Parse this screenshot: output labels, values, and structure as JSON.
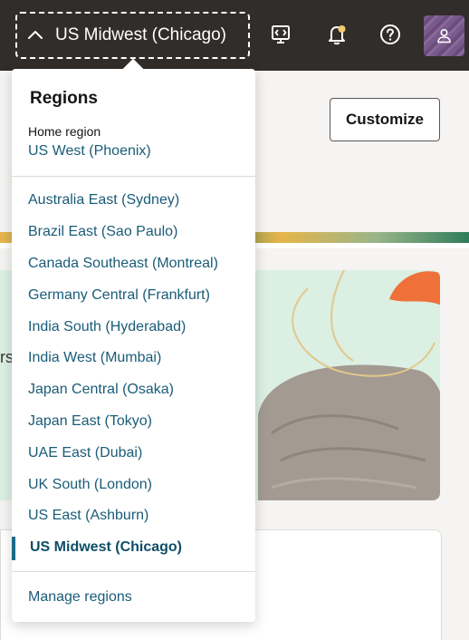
{
  "header": {
    "current_region": "US Midwest (Chicago)"
  },
  "page": {
    "customize_label": "Customize",
    "cutoff_text": "rs"
  },
  "regions_menu": {
    "title": "Regions",
    "home_label": "Home region",
    "home_value": "US West (Phoenix)",
    "items": [
      {
        "label": "Australia East (Sydney)",
        "selected": false
      },
      {
        "label": "Brazil East (Sao Paulo)",
        "selected": false
      },
      {
        "label": "Canada Southeast (Montreal)",
        "selected": false
      },
      {
        "label": "Germany Central (Frankfurt)",
        "selected": false
      },
      {
        "label": "India South (Hyderabad)",
        "selected": false
      },
      {
        "label": "India West (Mumbai)",
        "selected": false
      },
      {
        "label": "Japan Central (Osaka)",
        "selected": false
      },
      {
        "label": "Japan East (Tokyo)",
        "selected": false
      },
      {
        "label": "UAE East (Dubai)",
        "selected": false
      },
      {
        "label": "UK South (London)",
        "selected": false
      },
      {
        "label": "US East (Ashburn)",
        "selected": false
      },
      {
        "label": "US Midwest (Chicago)",
        "selected": true
      }
    ],
    "manage_label": "Manage regions"
  },
  "icons": {
    "region_toggle": "chevron-up-icon",
    "cloud_shell": "cloud-shell-icon",
    "notifications": "bell-icon",
    "help": "help-icon",
    "profile": "user-icon"
  },
  "colors": {
    "topbar": "#312d2a",
    "link": "#1a5c78",
    "selected_indicator": "#1a6b8a",
    "notification_dot": "#f0cc71"
  }
}
